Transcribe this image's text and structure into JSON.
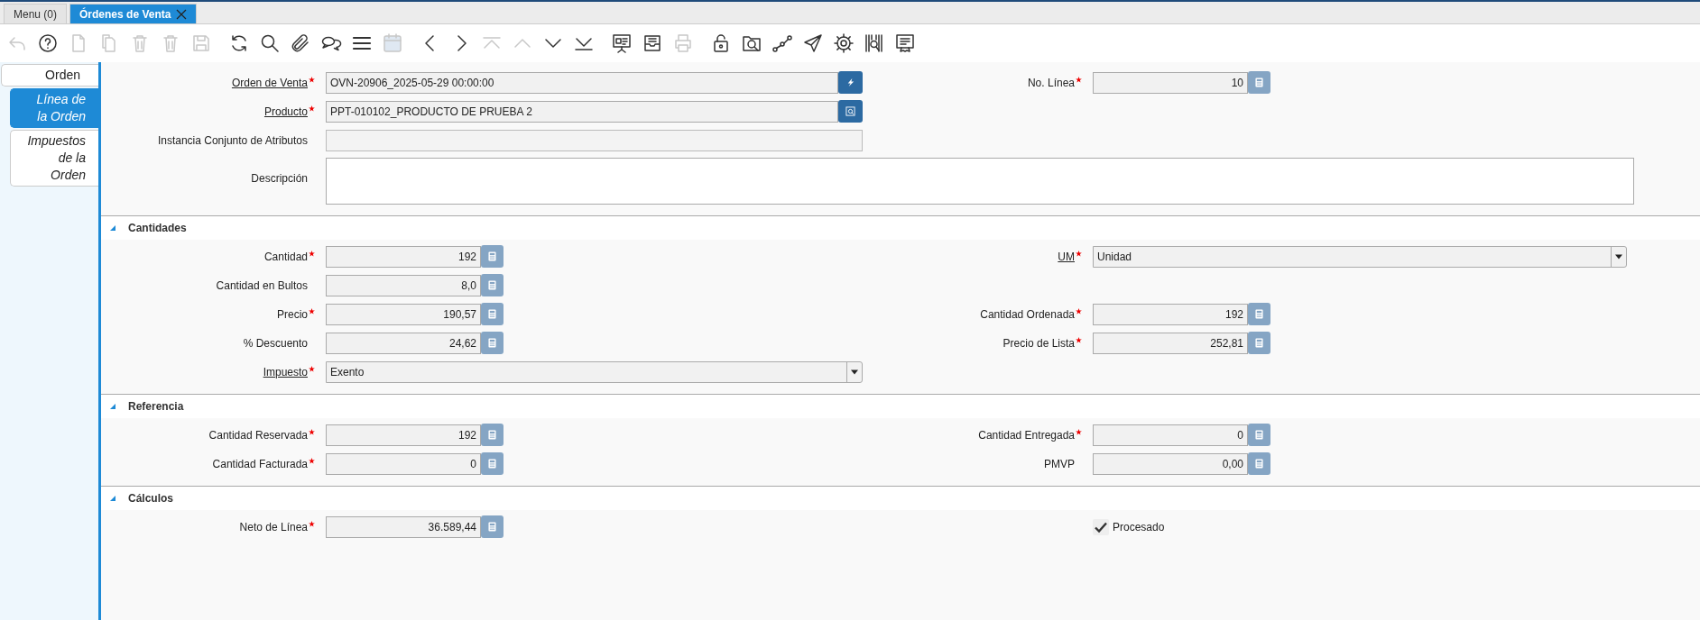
{
  "window_tabs": [
    {
      "label": "Menu (0)",
      "selected": false,
      "closable": false
    },
    {
      "label": "Órdenes de Venta",
      "selected": true,
      "closable": true
    }
  ],
  "toolbar": [
    {
      "kind": "undo",
      "disabled": true
    },
    {
      "kind": "help",
      "disabled": false
    },
    {
      "kind": "new",
      "disabled": true
    },
    {
      "kind": "copy",
      "disabled": true
    },
    {
      "kind": "delete",
      "disabled": true
    },
    {
      "kind": "delete",
      "disabled": true
    },
    {
      "kind": "save",
      "disabled": true
    },
    {
      "kind": "refresh",
      "disabled": false
    },
    {
      "kind": "search",
      "disabled": false
    },
    {
      "kind": "attachment",
      "disabled": false
    },
    {
      "kind": "chat",
      "disabled": false
    },
    {
      "kind": "list",
      "disabled": false
    },
    {
      "kind": "calendar",
      "disabled": true
    },
    {
      "kind": "previous",
      "disabled": false
    },
    {
      "kind": "next",
      "disabled": false
    },
    {
      "kind": "first",
      "disabled": true
    },
    {
      "kind": "up",
      "disabled": true
    },
    {
      "kind": "down",
      "disabled": false
    },
    {
      "kind": "last",
      "disabled": false
    },
    {
      "kind": "report",
      "disabled": false
    },
    {
      "kind": "archive",
      "disabled": false
    },
    {
      "kind": "print",
      "disabled": true
    },
    {
      "kind": "lock",
      "disabled": false
    },
    {
      "kind": "folder-search",
      "disabled": false
    },
    {
      "kind": "workflow",
      "disabled": false
    },
    {
      "kind": "send",
      "disabled": false
    },
    {
      "kind": "settings",
      "disabled": false
    },
    {
      "kind": "barcode",
      "disabled": false
    },
    {
      "kind": "document",
      "disabled": false
    }
  ],
  "sidebar_tabs": [
    {
      "label": "Orden",
      "selected": false,
      "italic": false
    },
    {
      "label": "Línea de la Orden",
      "selected": true,
      "italic": true
    },
    {
      "label": "Impuestos de la Orden",
      "selected": false,
      "italic": true
    }
  ],
  "sections": [
    {
      "rows": [
        {
          "left": {
            "label": "Orden de Venta",
            "required": true,
            "link": true,
            "kind": "record",
            "value": "OVN-20906_2025-05-29 00:00:00"
          },
          "right": {
            "label": "No. Línea",
            "required": true,
            "link": false,
            "kind": "number",
            "value": "10"
          }
        },
        {
          "left": {
            "label": "Producto",
            "required": true,
            "link": true,
            "kind": "search",
            "value": "PPT-010102_PRODUCTO DE PRUEBA 2"
          }
        },
        {
          "left": {
            "label": "Instancia Conjunto de Atributos",
            "required": false,
            "link": false,
            "kind": "text"
          }
        },
        {
          "left": {
            "label": "Descripción",
            "required": false,
            "link": false,
            "kind": "textarea"
          }
        }
      ]
    },
    {
      "title": "Cantidades",
      "expanded": true,
      "rows": [
        {
          "left": {
            "label": "Cantidad",
            "required": true,
            "link": false,
            "kind": "number",
            "value": "192"
          },
          "right": {
            "label": "UM",
            "required": true,
            "link": true,
            "kind": "select",
            "value": "Unidad"
          }
        },
        {
          "left": {
            "label": "Cantidad en Bultos",
            "required": false,
            "link": false,
            "kind": "number",
            "value": "8,0"
          }
        },
        {
          "left": {
            "label": "Precio",
            "required": true,
            "link": false,
            "kind": "number",
            "value": "190,57"
          },
          "right": {
            "label": "Cantidad Ordenada",
            "required": true,
            "link": false,
            "kind": "number",
            "value": "192"
          }
        },
        {
          "left": {
            "label": "% Descuento",
            "required": false,
            "link": false,
            "kind": "number",
            "value": "24,62"
          },
          "right": {
            "label": "Precio de Lista",
            "required": true,
            "link": false,
            "kind": "number",
            "value": "252,81"
          }
        },
        {
          "left": {
            "label": "Impuesto",
            "required": true,
            "link": true,
            "kind": "select",
            "value": "Exento"
          }
        }
      ]
    },
    {
      "title": "Referencia",
      "expanded": true,
      "rows": [
        {
          "left": {
            "label": "Cantidad Reservada",
            "required": true,
            "link": false,
            "kind": "number",
            "value": "192"
          },
          "right": {
            "label": "Cantidad Entregada",
            "required": true,
            "link": false,
            "kind": "number",
            "value": "0"
          }
        },
        {
          "left": {
            "label": "Cantidad Facturada",
            "required": true,
            "link": false,
            "kind": "number",
            "value": "0"
          },
          "right": {
            "label": "PMVP",
            "required": false,
            "link": false,
            "kind": "number",
            "value": "0,00"
          }
        }
      ]
    },
    {
      "title": "Cálculos",
      "expanded": true,
      "rows": [
        {
          "left": {
            "label": "Neto de Línea",
            "required": true,
            "link": false,
            "kind": "number",
            "value": "36.589,44"
          },
          "right": {
            "label": "Procesado",
            "kind": "checkbox",
            "checked": true
          }
        }
      ]
    }
  ]
}
